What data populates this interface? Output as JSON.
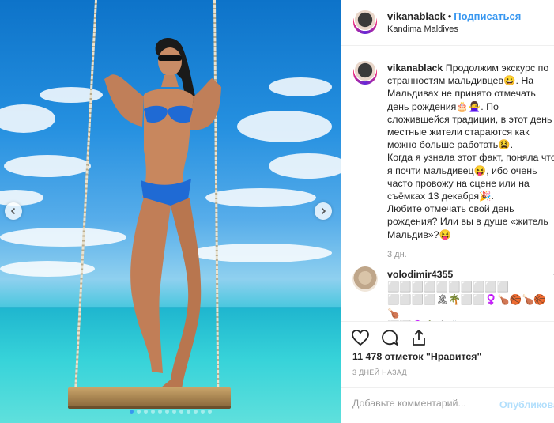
{
  "post": {
    "username": "vikanablack",
    "separator": "•",
    "follow_label": "Подписаться",
    "location": "Kandima Maldives"
  },
  "caption": {
    "username": "vikanablack",
    "text": "Продолжим экскурс по\nстранностям мальдивцев😀. На\nМальдивах не принято отмечать\nдень рождения🎂🙅‍♀️. По\nсложившейся традиции, в этот день\nместные жители стараются как\nможно больше работать😫.\nКогда я узнала этот факт, поняла что\nя почти мальдивец😝, ибо очень\nчасто провожу на сцене или на\nсъёмках 13 декабря🎉.\nЛюбите отмечать свой день\nрождения? Или вы в душе «житель\nМальдив»?😝",
    "time": "3 дн."
  },
  "comment": {
    "username": "volodimir4355",
    "text": "⬜⬜⬜⬜⬜⬜⬜⬜⬜⬜\n⬜⬜⬜⬜🏝🌴⬜⬜♀️🍗🏀🍗🏀🍗\n⬜⬜♀️🌴🏝🙇 какие формы\nсердце аж трепещит а красота"
  },
  "actions": {
    "likes": "11 478 отметок \"Нравится\"",
    "date": "3 ДНЕЙ НАЗАД"
  },
  "composer": {
    "placeholder": "Добавьте комментарий...",
    "post_label": "Опубликовать"
  },
  "carousel": {
    "slides": 12,
    "active": 0
  },
  "colors": {
    "accent": "#3897f0",
    "text": "#262626",
    "muted": "#999999",
    "post_disabled": "#b2dffc"
  }
}
